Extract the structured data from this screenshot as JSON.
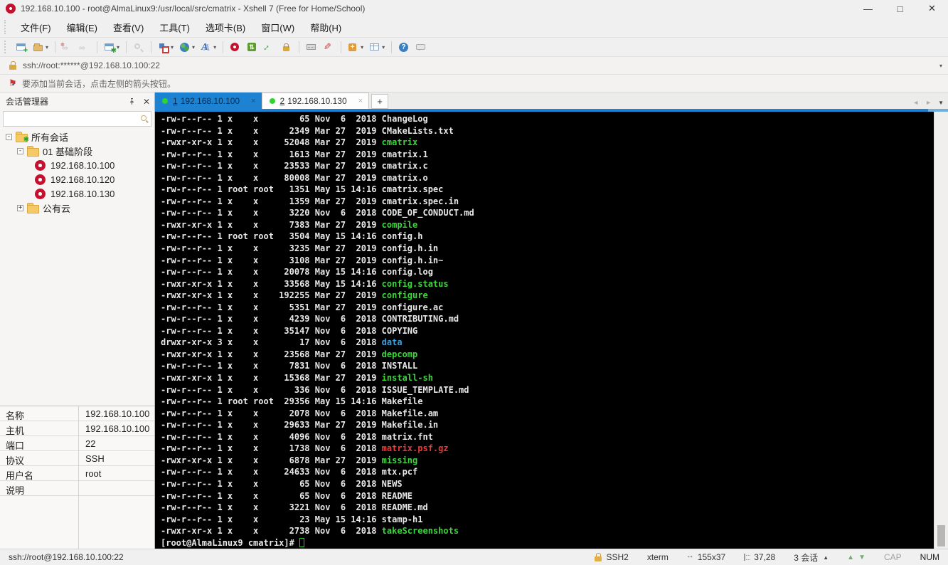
{
  "window": {
    "title": "192.168.10.100 - root@AlmaLinux9:/usr/local/src/cmatrix - Xshell 7 (Free for Home/School)",
    "controls": {
      "minimize": "—",
      "maximize": "□",
      "close": "✕"
    }
  },
  "menu": {
    "items": [
      "文件(F)",
      "编辑(E)",
      "查看(V)",
      "工具(T)",
      "选项卡(B)",
      "窗口(W)",
      "帮助(H)"
    ]
  },
  "toolbar": {
    "icons": [
      "new-session",
      "open-session-dropdown",
      "disconnect",
      "reconnect",
      "session-properties-dropdown",
      "find",
      "color-scheme-dropdown",
      "locale-dropdown",
      "font-dropdown",
      "xshell",
      "xftp",
      "fullscreen",
      "lock-screen",
      "virtual-keyboard",
      "highlight-pen",
      "new-transfer-dropdown",
      "split-view-dropdown",
      "help",
      "feedback"
    ]
  },
  "address_bar": {
    "url": "ssh://root:******@192.168.10.100:22"
  },
  "info_bar": {
    "text": "要添加当前会话，点击左侧的箭头按钮。"
  },
  "session_manager": {
    "title": "会话管理器",
    "search_placeholder": "",
    "tree": {
      "root_label": "所有会话",
      "folders": [
        {
          "label": "01 基础阶段",
          "expanded": "-"
        },
        {
          "label": "公有云",
          "expanded": "+"
        }
      ],
      "sessions": [
        {
          "label": "192.168.10.100"
        },
        {
          "label": "192.168.10.120"
        },
        {
          "label": "192.168.10.130"
        }
      ]
    },
    "properties": {
      "rows": [
        {
          "label": "名称",
          "value": "192.168.10.100"
        },
        {
          "label": "主机",
          "value": "192.168.10.100"
        },
        {
          "label": "端口",
          "value": "22"
        },
        {
          "label": "协议",
          "value": "SSH"
        },
        {
          "label": "用户名",
          "value": "root"
        },
        {
          "label": "说明",
          "value": ""
        }
      ]
    }
  },
  "tabs": {
    "items": [
      {
        "num": "1",
        "label": "192.168.10.100",
        "close": "×",
        "active": true
      },
      {
        "num": "2",
        "label": "192.168.10.130",
        "close": "×",
        "active": false
      }
    ],
    "new_tab": "+"
  },
  "terminal": {
    "lines": [
      {
        "pre": "-rw-r--r-- 1 x    x        65 Nov  6  2018 ",
        "name": "ChangeLog",
        "type": "file"
      },
      {
        "pre": "-rw-r--r-- 1 x    x      2349 Mar 27  2019 ",
        "name": "CMakeLists.txt",
        "type": "file"
      },
      {
        "pre": "-rwxr-xr-x 1 x    x     52048 Mar 27  2019 ",
        "name": "cmatrix",
        "type": "exec"
      },
      {
        "pre": "-rw-r--r-- 1 x    x      1613 Mar 27  2019 ",
        "name": "cmatrix.1",
        "type": "file"
      },
      {
        "pre": "-rw-r--r-- 1 x    x     23533 Mar 27  2019 ",
        "name": "cmatrix.c",
        "type": "file"
      },
      {
        "pre": "-rw-r--r-- 1 x    x     80008 Mar 27  2019 ",
        "name": "cmatrix.o",
        "type": "file"
      },
      {
        "pre": "-rw-r--r-- 1 root root   1351 May 15 14:16 ",
        "name": "cmatrix.spec",
        "type": "file"
      },
      {
        "pre": "-rw-r--r-- 1 x    x      1359 Mar 27  2019 ",
        "name": "cmatrix.spec.in",
        "type": "file"
      },
      {
        "pre": "-rw-r--r-- 1 x    x      3220 Nov  6  2018 ",
        "name": "CODE_OF_CONDUCT.md",
        "type": "file"
      },
      {
        "pre": "-rwxr-xr-x 1 x    x      7383 Mar 27  2019 ",
        "name": "compile",
        "type": "exec"
      },
      {
        "pre": "-rw-r--r-- 1 root root   3504 May 15 14:16 ",
        "name": "config.h",
        "type": "file"
      },
      {
        "pre": "-rw-r--r-- 1 x    x      3235 Mar 27  2019 ",
        "name": "config.h.in",
        "type": "file"
      },
      {
        "pre": "-rw-r--r-- 1 x    x      3108 Mar 27  2019 ",
        "name": "config.h.in~",
        "type": "file"
      },
      {
        "pre": "-rw-r--r-- 1 x    x     20078 May 15 14:16 ",
        "name": "config.log",
        "type": "file"
      },
      {
        "pre": "-rwxr-xr-x 1 x    x     33568 May 15 14:16 ",
        "name": "config.status",
        "type": "exec"
      },
      {
        "pre": "-rwxr-xr-x 1 x    x    192255 Mar 27  2019 ",
        "name": "configure",
        "type": "exec"
      },
      {
        "pre": "-rw-r--r-- 1 x    x      5351 Mar 27  2019 ",
        "name": "configure.ac",
        "type": "file"
      },
      {
        "pre": "-rw-r--r-- 1 x    x      4239 Nov  6  2018 ",
        "name": "CONTRIBUTING.md",
        "type": "file"
      },
      {
        "pre": "-rw-r--r-- 1 x    x     35147 Nov  6  2018 ",
        "name": "COPYING",
        "type": "file"
      },
      {
        "pre": "drwxr-xr-x 3 x    x        17 Nov  6  2018 ",
        "name": "data",
        "type": "dir"
      },
      {
        "pre": "-rwxr-xr-x 1 x    x     23568 Mar 27  2019 ",
        "name": "depcomp",
        "type": "exec"
      },
      {
        "pre": "-rw-r--r-- 1 x    x      7831 Nov  6  2018 ",
        "name": "INSTALL",
        "type": "file"
      },
      {
        "pre": "-rwxr-xr-x 1 x    x     15368 Mar 27  2019 ",
        "name": "install-sh",
        "type": "exec"
      },
      {
        "pre": "-rw-r--r-- 1 x    x       336 Nov  6  2018 ",
        "name": "ISSUE_TEMPLATE.md",
        "type": "file"
      },
      {
        "pre": "-rw-r--r-- 1 root root  29356 May 15 14:16 ",
        "name": "Makefile",
        "type": "file"
      },
      {
        "pre": "-rw-r--r-- 1 x    x      2078 Nov  6  2018 ",
        "name": "Makefile.am",
        "type": "file"
      },
      {
        "pre": "-rw-r--r-- 1 x    x     29633 Mar 27  2019 ",
        "name": "Makefile.in",
        "type": "file"
      },
      {
        "pre": "-rw-r--r-- 1 x    x      4096 Nov  6  2018 ",
        "name": "matrix.fnt",
        "type": "file"
      },
      {
        "pre": "-rw-r--r-- 1 x    x      1738 Nov  6  2018 ",
        "name": "matrix.psf.gz",
        "type": "archive"
      },
      {
        "pre": "-rwxr-xr-x 1 x    x      6878 Mar 27  2019 ",
        "name": "missing",
        "type": "exec"
      },
      {
        "pre": "-rw-r--r-- 1 x    x     24633 Nov  6  2018 ",
        "name": "mtx.pcf",
        "type": "file"
      },
      {
        "pre": "-rw-r--r-- 1 x    x        65 Nov  6  2018 ",
        "name": "NEWS",
        "type": "file"
      },
      {
        "pre": "-rw-r--r-- 1 x    x        65 Nov  6  2018 ",
        "name": "README",
        "type": "file"
      },
      {
        "pre": "-rw-r--r-- 1 x    x      3221 Nov  6  2018 ",
        "name": "README.md",
        "type": "file"
      },
      {
        "pre": "-rw-r--r-- 1 x    x        23 May 15 14:16 ",
        "name": "stamp-h1",
        "type": "file"
      },
      {
        "pre": "-rwxr-xr-x 1 x    x      2738 Nov  6  2018 ",
        "name": "takeScreenshots",
        "type": "exec"
      }
    ],
    "prompt": "[root@AlmaLinux9 cmatrix]# "
  },
  "status_bar": {
    "left": "ssh://root@192.168.10.100:22",
    "protocol": "SSH2",
    "term_type": "xterm",
    "size": "155x37",
    "cursor_pos": "37,28",
    "sessions": "3 会话",
    "cap": "CAP",
    "num": "NUM"
  },
  "colors": {
    "accent_blue": "#1e82d2",
    "terminal_bg": "#000000",
    "terminal_fg": "#e8e8e8",
    "exec_green": "#3ad63a",
    "dir_blue": "#3b9fd9",
    "archive_red": "#e93a3a",
    "status_dot_green": "#2fd52f",
    "xshell_red": "#c8102e"
  }
}
